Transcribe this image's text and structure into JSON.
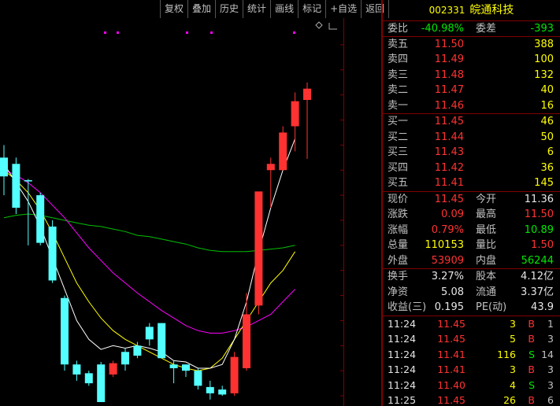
{
  "toolbar": [
    "复权",
    "叠加",
    "历史",
    "统计",
    "画线",
    "标记",
    "+自选",
    "返回"
  ],
  "stock": {
    "code": "002331",
    "name": "皖通科技"
  },
  "weibi": {
    "label": "委比",
    "value": "-40.98%",
    "label2": "委差",
    "value2": "-393"
  },
  "asks": [
    {
      "label": "卖五",
      "price": "11.50",
      "vol": "388"
    },
    {
      "label": "卖四",
      "price": "11.49",
      "vol": "100"
    },
    {
      "label": "卖三",
      "price": "11.48",
      "vol": "132"
    },
    {
      "label": "卖二",
      "price": "11.47",
      "vol": "40"
    },
    {
      "label": "卖一",
      "price": "11.46",
      "vol": "16"
    }
  ],
  "bids": [
    {
      "label": "买一",
      "price": "11.45",
      "vol": "46"
    },
    {
      "label": "买二",
      "price": "11.44",
      "vol": "50"
    },
    {
      "label": "买三",
      "price": "11.43",
      "vol": "6"
    },
    {
      "label": "买四",
      "price": "11.42",
      "vol": "36"
    },
    {
      "label": "买五",
      "price": "11.41",
      "vol": "145"
    }
  ],
  "stats": [
    {
      "l1": "现价",
      "v1": "11.45",
      "c1": "red",
      "l2": "今开",
      "v2": "11.36",
      "c2": "white"
    },
    {
      "l1": "涨跌",
      "v1": "0.09",
      "c1": "red",
      "l2": "最高",
      "v2": "11.50",
      "c2": "red"
    },
    {
      "l1": "涨幅",
      "v1": "0.79%",
      "c1": "red",
      "l2": "最低",
      "v2": "10.89",
      "c2": "green"
    },
    {
      "l1": "总量",
      "v1": "110153",
      "c1": "yellow",
      "l2": "量比",
      "v2": "1.50",
      "c2": "red"
    },
    {
      "l1": "外盘",
      "v1": "53909",
      "c1": "red",
      "l2": "内盘",
      "v2": "56244",
      "c2": "green"
    }
  ],
  "fund": [
    {
      "l1": "换手",
      "v1": "3.27%",
      "l2": "股本",
      "v2": "4.12亿"
    },
    {
      "l1": "净资",
      "v1": "5.08",
      "l2": "流通",
      "v2": "3.37亿"
    },
    {
      "l1": "收益(三)",
      "v1": "0.195",
      "l2": "PE(动)",
      "v2": "43.9"
    }
  ],
  "trades": [
    {
      "time": "11:24",
      "price": "11.45",
      "vol": "3",
      "side": "B",
      "cnt": "1"
    },
    {
      "time": "11:24",
      "price": "11.45",
      "vol": "5",
      "side": "B",
      "cnt": "3"
    },
    {
      "time": "11:24",
      "price": "11.41",
      "vol": "116",
      "side": "S",
      "cnt": "14"
    },
    {
      "time": "11:24",
      "price": "11.41",
      "vol": "3",
      "side": "B",
      "cnt": "3"
    },
    {
      "time": "11:24",
      "price": "11.40",
      "vol": "4",
      "side": "S",
      "cnt": "3"
    },
    {
      "time": "11:25",
      "price": "11.45",
      "vol": "26",
      "side": "B",
      "cnt": "6"
    }
  ],
  "colors": {
    "up": "#ff3232",
    "down": "#54ffff",
    "ma_white": "#ffffff",
    "ma_yellow": "#ffff00",
    "ma_magenta": "#ff00ff",
    "ma_green": "#00c000"
  },
  "chart_data": {
    "type": "candlestick",
    "ylim": [
      8.95,
      11.95
    ],
    "yticks": [
      "11.80",
      "11.60",
      "11.40",
      "11.20",
      "11.00",
      "10.80",
      "10.60",
      "10.40",
      "10.20",
      "10.00",
      "9.80",
      "9.60",
      "9.40",
      "9.20",
      "9.00"
    ],
    "candles": [
      {
        "o": 10.9,
        "h": 11.0,
        "l": 10.6,
        "c": 10.75
      },
      {
        "o": 10.85,
        "h": 10.9,
        "l": 10.45,
        "c": 10.5
      },
      {
        "o": 10.72,
        "h": 10.73,
        "l": 10.2,
        "c": 10.71
      },
      {
        "o": 10.6,
        "h": 10.62,
        "l": 10.2,
        "c": 10.22
      },
      {
        "o": 10.35,
        "h": 10.4,
        "l": 9.9,
        "c": 9.92
      },
      {
        "o": 9.78,
        "h": 9.8,
        "l": 9.2,
        "c": 9.25
      },
      {
        "o": 9.25,
        "h": 9.28,
        "l": 9.12,
        "c": 9.17
      },
      {
        "o": 9.18,
        "h": 9.2,
        "l": 9.08,
        "c": 9.1
      },
      {
        "o": 9.25,
        "h": 9.27,
        "l": 8.95,
        "c": 8.95
      },
      {
        "o": 9.17,
        "h": 9.28,
        "l": 9.15,
        "c": 9.26
      },
      {
        "o": 9.35,
        "h": 9.38,
        "l": 9.2,
        "c": 9.25
      },
      {
        "o": 9.4,
        "h": 9.43,
        "l": 9.3,
        "c": 9.32
      },
      {
        "o": 9.55,
        "h": 9.58,
        "l": 9.4,
        "c": 9.45
      },
      {
        "o": 9.58,
        "h": 9.58,
        "l": 9.3,
        "c": 9.3
      },
      {
        "o": 9.25,
        "h": 9.28,
        "l": 9.1,
        "c": 9.22
      },
      {
        "o": 9.25,
        "h": 9.25,
        "l": 9.15,
        "c": 9.2
      },
      {
        "o": 9.2,
        "h": 9.22,
        "l": 9.05,
        "c": 9.08
      },
      {
        "o": 9.07,
        "h": 9.12,
        "l": 8.97,
        "c": 9.02
      },
      {
        "o": 9.05,
        "h": 9.08,
        "l": 9.0,
        "c": 9.01
      },
      {
        "o": 9.02,
        "h": 9.35,
        "l": 9.0,
        "c": 9.31
      },
      {
        "o": 9.22,
        "h": 9.82,
        "l": 9.2,
        "c": 9.65
      },
      {
        "o": 9.72,
        "h": 10.6,
        "l": 9.65,
        "c": 10.63
      },
      {
        "o": 10.8,
        "h": 10.9,
        "l": 10.5,
        "c": 10.85
      },
      {
        "o": 10.8,
        "h": 11.15,
        "l": 10.8,
        "c": 11.1
      },
      {
        "o": 11.15,
        "h": 11.42,
        "l": 10.95,
        "c": 11.35
      },
      {
        "o": 11.36,
        "h": 11.5,
        "l": 10.89,
        "c": 11.45
      }
    ],
    "ma_white": [
      10.85,
      10.7,
      10.55,
      10.35,
      10.1,
      9.85,
      9.6,
      9.45,
      9.37,
      9.4,
      9.38,
      9.4,
      9.38,
      9.35,
      9.28,
      9.27,
      9.22,
      9.22,
      9.25,
      9.45,
      9.75,
      10.15,
      10.5,
      10.8,
      11.05
    ],
    "ma_yellow": [
      10.8,
      10.72,
      10.62,
      10.48,
      10.3,
      10.1,
      9.9,
      9.75,
      9.62,
      9.52,
      9.45,
      9.4,
      9.35,
      9.3,
      9.25,
      9.22,
      9.2,
      9.22,
      9.3,
      9.45,
      9.6,
      9.75,
      9.9,
      10.0,
      10.15
    ],
    "ma_magenta": [
      10.8,
      10.76,
      10.7,
      10.62,
      10.52,
      10.42,
      10.3,
      10.18,
      10.08,
      9.98,
      9.9,
      9.82,
      9.75,
      9.68,
      9.62,
      9.56,
      9.52,
      9.5,
      9.5,
      9.52,
      9.55,
      9.6,
      9.65,
      9.75,
      9.85
    ],
    "ma_green": [
      10.42,
      10.44,
      10.45,
      10.44,
      10.42,
      10.4,
      10.38,
      10.36,
      10.35,
      10.33,
      10.31,
      10.28,
      10.27,
      10.25,
      10.23,
      10.21,
      10.18,
      10.16,
      10.15,
      10.15,
      10.15,
      10.16,
      10.17,
      10.18,
      10.2
    ]
  }
}
